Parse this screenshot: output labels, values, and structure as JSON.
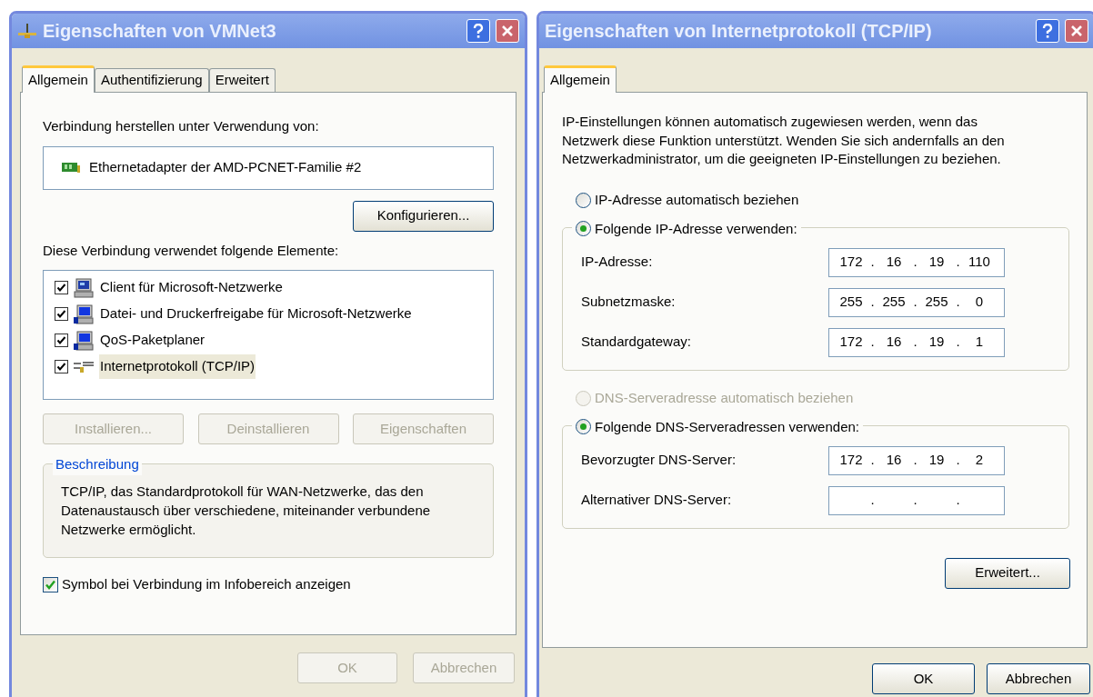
{
  "connection_dialog": {
    "title": "Eigenschaften von VMNet3",
    "tabs": [
      {
        "label": "Allgemein",
        "selected": true
      },
      {
        "label": "Authentifizierung",
        "selected": false
      },
      {
        "label": "Erweitert",
        "selected": false
      }
    ],
    "connect_label": "Verbindung herstellen unter Verwendung von:",
    "adapter": "Ethernetadapter der AMD-PCNET-Familie #2",
    "configure_button": "Konfigurieren...",
    "components_label": "Diese Verbindung verwendet folgende Elemente:",
    "components": [
      {
        "label": "Client für Microsoft-Netzwerke",
        "kind": "client",
        "checked": true,
        "selected": false
      },
      {
        "label": "Datei- und Druckerfreigabe für Microsoft-Netzwerke",
        "kind": "service",
        "checked": true,
        "selected": false
      },
      {
        "label": "QoS-Paketplaner",
        "kind": "service",
        "checked": true,
        "selected": false
      },
      {
        "label": "Internetprotokoll (TCP/IP)",
        "kind": "protocol",
        "checked": true,
        "selected": true
      }
    ],
    "component_buttons": [
      {
        "label": "Installieren...",
        "disabled": true
      },
      {
        "label": "Deinstallieren",
        "disabled": true
      },
      {
        "label": "Eigenschaften",
        "disabled": true
      }
    ],
    "description": {
      "title": "Beschreibung",
      "text": "TCP/IP, das Standardprotokoll für WAN-Netzwerke, das den Datenaustausch über verschiedene, miteinander verbundene Netzwerke ermöglicht."
    },
    "tray_icon": {
      "label": "Symbol bei Verbindung im Infobereich anzeigen",
      "checked": true
    },
    "buttons": [
      {
        "label": "OK",
        "disabled": true
      },
      {
        "label": "Abbrechen",
        "disabled": true
      }
    ]
  },
  "tcpip_dialog": {
    "title": "Eigenschaften von Internetprotokoll (TCP/IP)",
    "tabs": [
      {
        "label": "Allgemein",
        "selected": true
      }
    ],
    "intro": "IP-Einstellungen können automatisch zugewiesen werden, wenn das Netzwerk diese Funktion unterstützt. Wenden Sie sich andernfalls an den Netzwerkadministrator, um die geeigneten IP-Einstellungen zu beziehen.",
    "ip_options": [
      {
        "label": "IP-Adresse automatisch beziehen",
        "selected": false,
        "disabled": false
      },
      {
        "label": "Folgende IP-Adresse verwenden:",
        "selected": true,
        "disabled": false
      }
    ],
    "ip_fields": [
      {
        "label": "IP-Adresse:",
        "octets": [
          {
            "text": "172",
            "dot": "."
          },
          {
            "text": "16",
            "dot": "."
          },
          {
            "text": "19",
            "dot": "."
          },
          {
            "text": "110"
          }
        ]
      },
      {
        "label": "Subnetzmaske:",
        "octets": [
          {
            "text": "255",
            "dot": "."
          },
          {
            "text": "255",
            "dot": "."
          },
          {
            "text": "255",
            "dot": "."
          },
          {
            "text": "0"
          }
        ]
      },
      {
        "label": "Standardgateway:",
        "octets": [
          {
            "text": "172",
            "dot": "."
          },
          {
            "text": "16",
            "dot": "."
          },
          {
            "text": "19",
            "dot": "."
          },
          {
            "text": "1"
          }
        ]
      }
    ],
    "dns_options": [
      {
        "label": "DNS-Serveradresse automatisch beziehen",
        "selected": false,
        "disabled": true
      },
      {
        "label": "Folgende DNS-Serveradressen verwenden:",
        "selected": true,
        "disabled": false
      }
    ],
    "dns_fields": [
      {
        "label": "Bevorzugter DNS-Server:",
        "octets": [
          {
            "text": "172",
            "dot": "."
          },
          {
            "text": "16",
            "dot": "."
          },
          {
            "text": "19",
            "dot": "."
          },
          {
            "text": "2"
          }
        ]
      },
      {
        "label": "Alternativer DNS-Server:",
        "octets": [
          {
            "dot": "."
          },
          {
            "dot": "."
          },
          {
            "dot": "."
          }
        ]
      }
    ],
    "advanced_button": "Erweitert...",
    "buttons": [
      {
        "label": "OK",
        "disabled": false
      },
      {
        "label": "Abbrechen",
        "disabled": false
      }
    ]
  }
}
